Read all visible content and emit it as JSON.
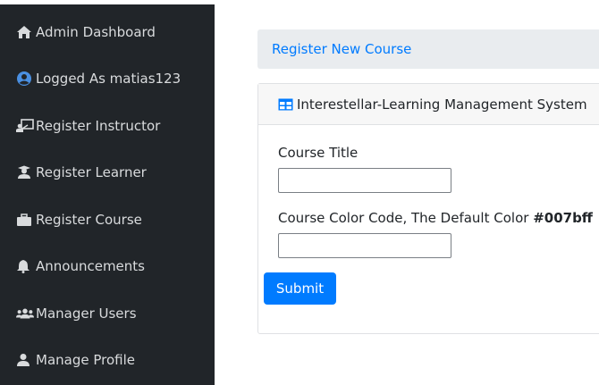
{
  "sidebar": {
    "items": [
      {
        "label": "Admin Dashboard",
        "icon": "home-icon"
      },
      {
        "label": "Logged As matias123",
        "icon": "user-circle-icon"
      },
      {
        "label": "Register Instructor",
        "icon": "chalkboard-teacher-icon"
      },
      {
        "label": "Register Learner",
        "icon": "user-graduate-icon"
      },
      {
        "label": "Register Course",
        "icon": "briefcase-icon"
      },
      {
        "label": "Announcements",
        "icon": "bell-icon"
      },
      {
        "label": "Manager Users",
        "icon": "users-icon"
      },
      {
        "label": "Manage Profile",
        "icon": "user-icon"
      }
    ]
  },
  "breadcrumb": {
    "label": "Register New Course"
  },
  "card": {
    "title": "Interestellar-Learning Management System",
    "icon": "table-icon",
    "fields": {
      "course_title_label": "Course Title",
      "course_title_value": "",
      "color_label": "Course Color Code, The Default Color ",
      "color_default": "#007bff",
      "color_value": ""
    },
    "submit_label": "Submit"
  },
  "colors": {
    "sidebar_bg": "#212529",
    "accent": "#007bff",
    "breadcrumb_bg": "#e9ecef"
  }
}
